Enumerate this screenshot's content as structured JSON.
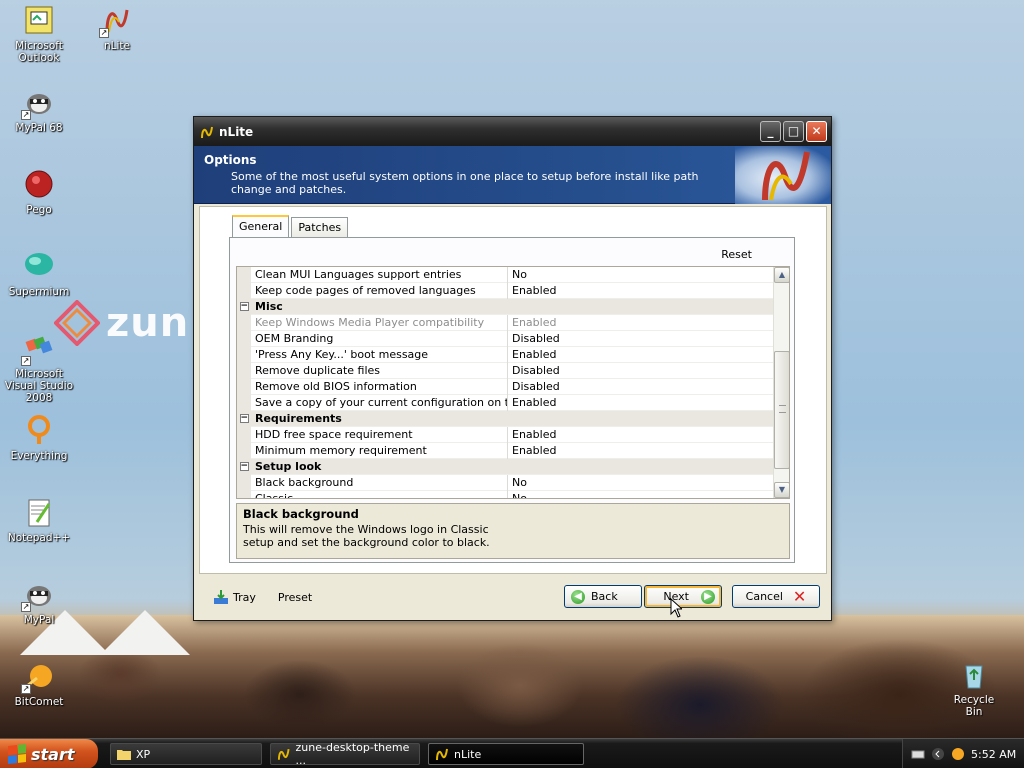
{
  "desktop": {
    "icons": [
      {
        "label": "Microsoft Outlook",
        "icon": "outlook-icon"
      },
      {
        "label": "nLite",
        "icon": "nlite-icon"
      },
      {
        "label": "MyPal 68",
        "icon": "mypal-icon"
      },
      {
        "label": "Pego",
        "icon": "pego-icon"
      },
      {
        "label": "Supermium",
        "icon": "supermium-icon"
      },
      {
        "label": "Microsoft Visual Studio 2008",
        "icon": "visual-studio-icon"
      },
      {
        "label": "Everything",
        "icon": "everything-icon"
      },
      {
        "label": "Notepad++",
        "icon": "notepadpp-icon"
      },
      {
        "label": "MyPal",
        "icon": "mypal-icon"
      },
      {
        "label": "BitComet",
        "icon": "bitcomet-icon"
      },
      {
        "label": "Recycle Bin",
        "icon": "recycle-bin-icon"
      }
    ],
    "wallpaper_text": "zun"
  },
  "window": {
    "title": "nLite",
    "banner_title": "Options",
    "banner_desc": "Some of the most useful system options in one place to setup before install like path change and patches.",
    "tabs": [
      "General",
      "Patches"
    ],
    "active_tab": "General",
    "reset_label": "Reset",
    "rows": [
      {
        "type": "item",
        "name": "Clean MUI Languages support entries",
        "value": "No"
      },
      {
        "type": "item",
        "name": "Keep code pages of removed languages",
        "value": "Enabled"
      },
      {
        "type": "category",
        "name": "Misc"
      },
      {
        "type": "item",
        "name": "Keep Windows Media Player compatibility",
        "value": "Enabled",
        "disabled": true
      },
      {
        "type": "item",
        "name": "OEM Branding",
        "value": "Disabled"
      },
      {
        "type": "item",
        "name": "'Press Any Key...' boot message",
        "value": "Enabled"
      },
      {
        "type": "item",
        "name": "Remove duplicate files",
        "value": "Disabled"
      },
      {
        "type": "item",
        "name": "Remove old BIOS information",
        "value": "Disabled"
      },
      {
        "type": "item",
        "name": "Save a copy of your current configuration on the ISO",
        "value": "Enabled"
      },
      {
        "type": "category",
        "name": "Requirements"
      },
      {
        "type": "item",
        "name": "HDD free space requirement",
        "value": "Enabled"
      },
      {
        "type": "item",
        "name": "Minimum memory requirement",
        "value": "Enabled"
      },
      {
        "type": "category",
        "name": "Setup look"
      },
      {
        "type": "item",
        "name": "Black background",
        "value": "No"
      },
      {
        "type": "item",
        "name": "Classic",
        "value": "No"
      }
    ],
    "description_title": "Black background",
    "description_text": "This will remove the Windows logo in Classic setup and set the background color to black.",
    "bottom": {
      "tray_label": "Tray",
      "preset_label": "Preset",
      "back_label": "Back",
      "next_label": "Next",
      "cancel_label": "Cancel"
    }
  },
  "taskbar": {
    "start_label": "start",
    "tasks": [
      {
        "label": "XP",
        "icon": "folder-icon"
      },
      {
        "label": "zune-desktop-theme ...",
        "icon": "nlite-icon"
      },
      {
        "label": "nLite",
        "icon": "nlite-icon",
        "active": true
      }
    ],
    "clock": "5:52 AM"
  }
}
